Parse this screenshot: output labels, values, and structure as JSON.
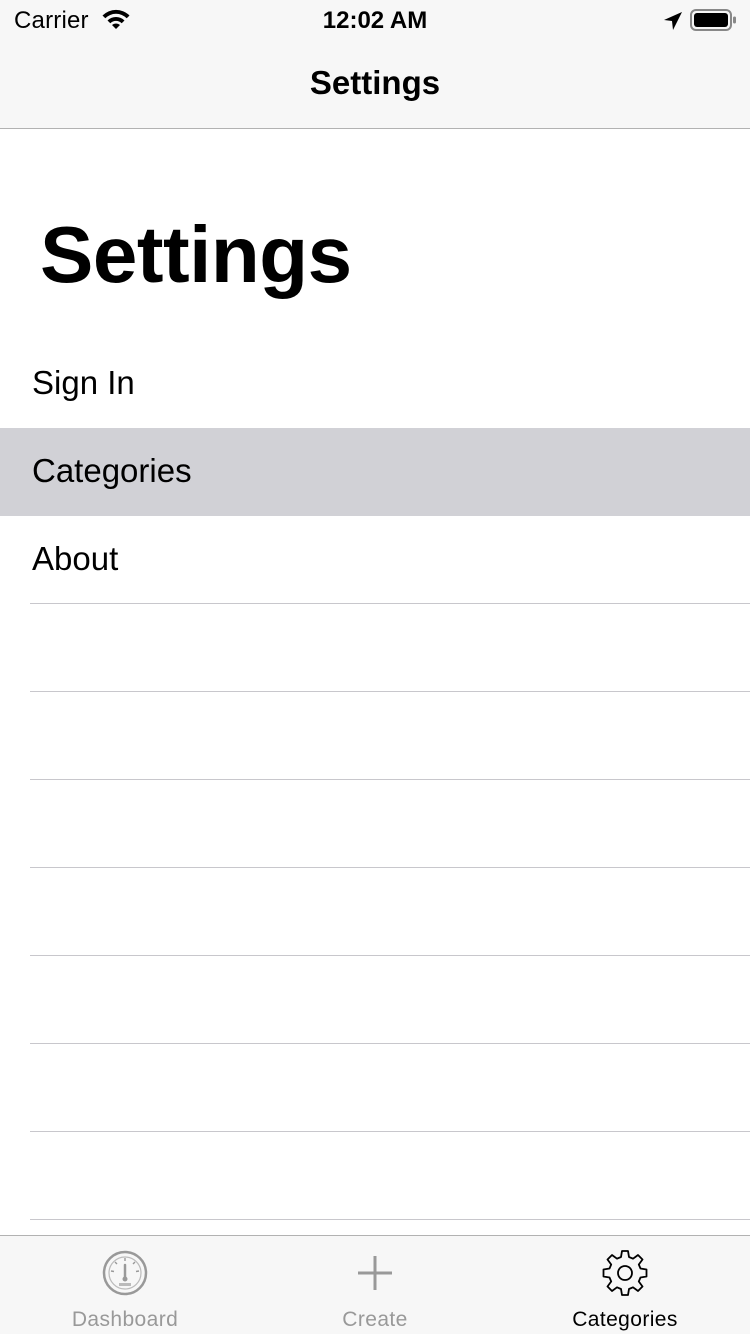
{
  "status_bar": {
    "carrier": "Carrier",
    "time": "12:02 AM",
    "icons": [
      "wifi-icon",
      "location-arrow-icon",
      "battery-icon"
    ]
  },
  "nav_bar": {
    "title": "Settings"
  },
  "main": {
    "large_title": "Settings",
    "rows": [
      {
        "label": "Sign In",
        "highlighted": false
      },
      {
        "label": "Categories",
        "highlighted": true
      },
      {
        "label": "About",
        "highlighted": false
      }
    ]
  },
  "tab_bar": {
    "tabs": [
      {
        "label": "Dashboard",
        "icon": "speedometer-icon",
        "active": false
      },
      {
        "label": "Create",
        "icon": "plus-icon",
        "active": false
      },
      {
        "label": "Categories",
        "icon": "gear-icon",
        "active": true
      }
    ]
  },
  "colors": {
    "bar_background": "#f7f7f7",
    "highlight_row": "#d1d1d6",
    "separator": "#c8c7cc",
    "inactive_tab": "#999999",
    "active_tab": "#000000"
  }
}
